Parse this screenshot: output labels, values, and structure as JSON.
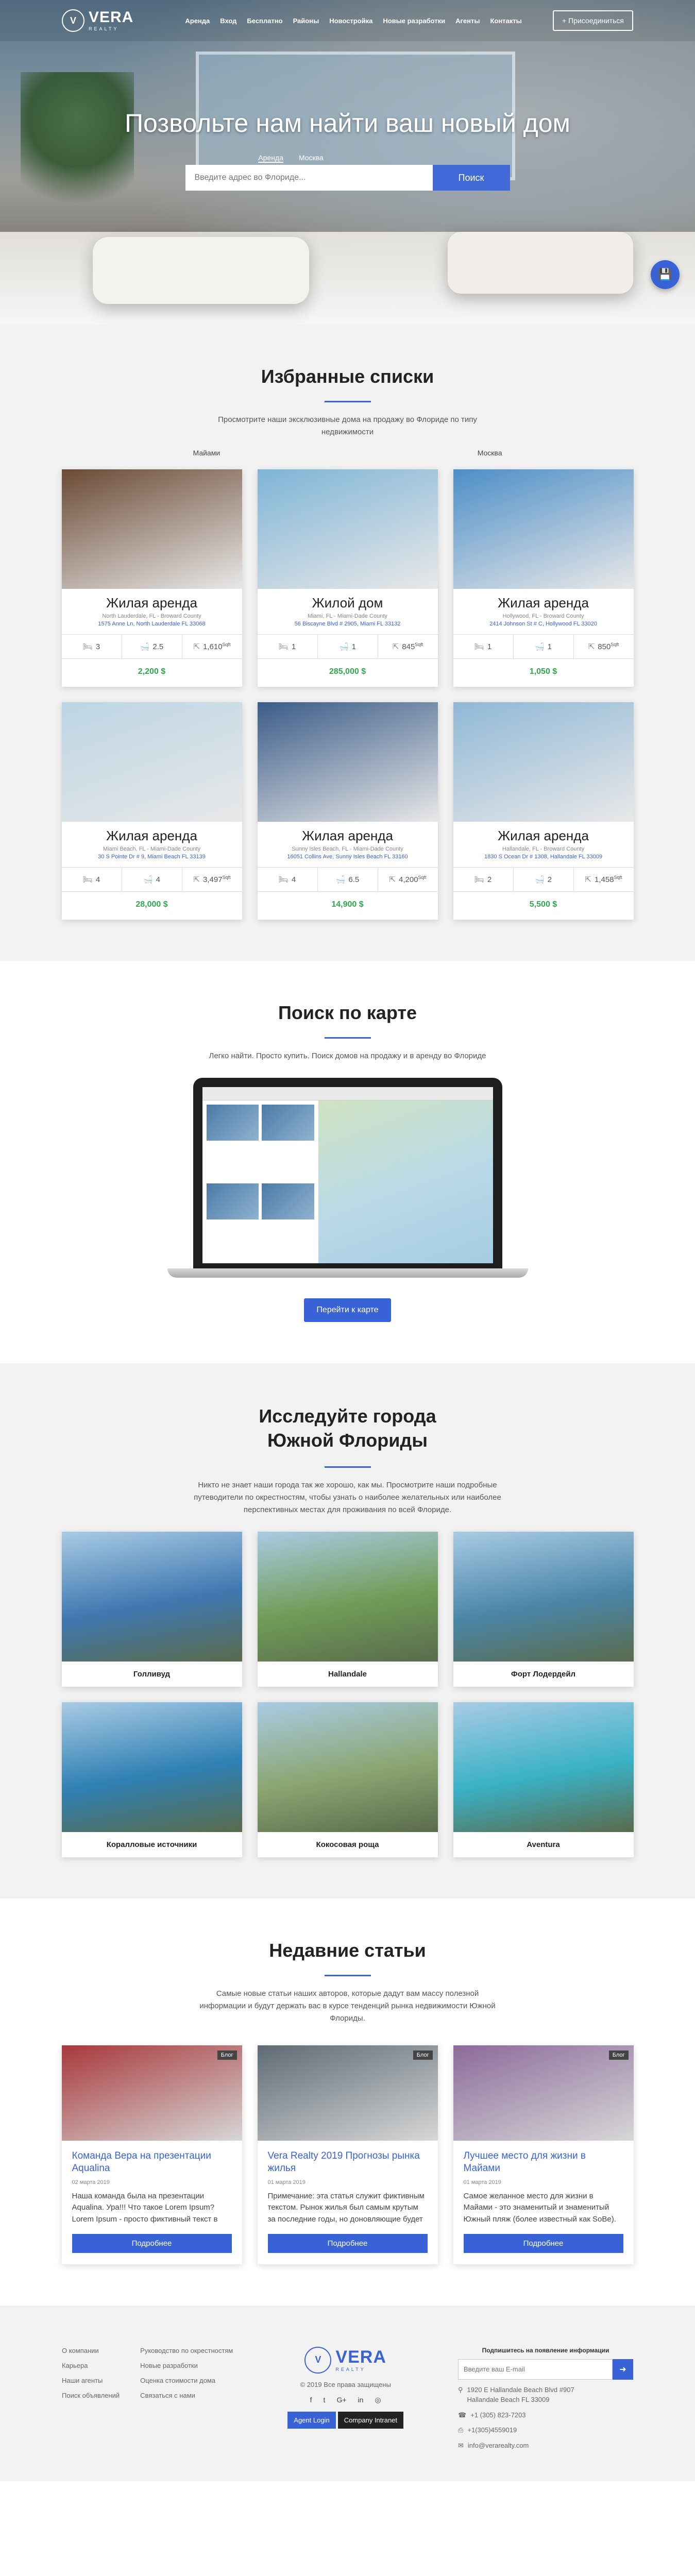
{
  "nav": {
    "logo_big": "VERA",
    "logo_small": "REALTY",
    "links": [
      "Аренда",
      "Вход",
      "Бесплатно",
      "Районы",
      "Новостройка",
      "Новые разработки",
      "Агенты",
      "Контакты"
    ],
    "join": "+ Присоединиться"
  },
  "hero": {
    "title": "Позвольте нам найти ваш новый дом",
    "tabs": [
      "Аренда",
      "Москва"
    ],
    "placeholder": "Введите адрес во Флориде...",
    "search_btn": "Поиск",
    "fab_icon": "save-icon"
  },
  "featured": {
    "title": "Избранные списки",
    "subtitle": "Просмотрите наши эксклюзивные дома на продажу во Флориде по типу недвижимости",
    "tabs": [
      "Майами",
      "Москва"
    ],
    "cards": [
      {
        "title": "Жилая аренда",
        "sub": "North Lauderdale, FL - Broward County",
        "addr": "1575 Anne Ln, North Lauderdale FL 33068",
        "beds": "3",
        "baths": "2.5",
        "area": "1,610",
        "price": "2,200 $"
      },
      {
        "title": "Жилой дом",
        "sub": "Miami, FL - Miami-Dade County",
        "addr": "56 Biscayne Blvd # 2905, Miami FL 33132",
        "beds": "1",
        "baths": "1",
        "area": "845",
        "price": "285,000 $"
      },
      {
        "title": "Жилая аренда",
        "sub": "Hollywood, FL - Broward County",
        "addr": "2414 Johnson St # C, Hollywood FL 33020",
        "beds": "1",
        "baths": "1",
        "area": "850",
        "price": "1,050 $"
      },
      {
        "title": "Жилая аренда",
        "sub": "Miami Beach, FL - Miami-Dade County",
        "addr": "30 S Pointe Dr # 9, Miami Beach FL 33139",
        "beds": "4",
        "baths": "4",
        "area": "3,497",
        "price": "28,000 $"
      },
      {
        "title": "Жилая аренда",
        "sub": "Sunny Isles Beach, FL - Miami-Dade County",
        "addr": "16051 Collins Ave, Sunny Isles Beach FL 33160",
        "beds": "4",
        "baths": "6.5",
        "area": "4,200",
        "price": "14,900 $"
      },
      {
        "title": "Жилая аренда",
        "sub": "Hallandale, FL - Broward County",
        "addr": "1830 S Ocean Dr # 1308, Hallandale FL 33009",
        "beds": "2",
        "baths": "2",
        "area": "1,458",
        "price": "5,500 $"
      }
    ],
    "area_unit": "Sqft",
    "colors": [
      "#6b4a34",
      "#7eb4d6",
      "#4c8ec7",
      "#bcd5e4",
      "#3b5c88",
      "#8fb8d6"
    ]
  },
  "map_search": {
    "title": "Поиск по карте",
    "subtitle": "Легко найти. Просто купить. Поиск домов на продажу и в аренду во Флориде",
    "button": "Перейти к карте"
  },
  "cities": {
    "title": "Исследуйте города Южной Флориды",
    "subtitle": "Никто не знает наши города так же хорошо, как мы. Просмотрите наши подробные путеводители по окрестностям, чтобы узнать о наиболее желательных или наиболее перспективных местах для проживания по всей Флориде.",
    "items": [
      "Голливуд",
      "Hallandale",
      "Форт Лодердейл",
      "Коралловые источники",
      "Кокосовая роща",
      "Aventura"
    ],
    "colors": [
      "#3f78b0",
      "#6f9c57",
      "#4a86a8",
      "#2f80b3",
      "#8aa570",
      "#39b1c6"
    ]
  },
  "articles": {
    "title": "Недавние статьи",
    "subtitle": "Самые новые статьи наших авторов, которые дадут вам массу полезной информации и будут держать вас в курсе тенденций рынка недвижимости Южной Флориды.",
    "badge": "Блог",
    "button": "Подробнее",
    "items": [
      {
        "title": "Команда Вера на презентации Aqualina",
        "date": "02 марта 2019",
        "text": "Наша команда была на презентации Aqualina. Ура!!! Что такое Lorem Ipsum? Lorem Ipsum - просто фиктивный текст в полиграфии и верстке. Лорем Ипсум"
      },
      {
        "title": "Vera Realty 2019 Прогнозы рынка жилья",
        "date": "01 марта 2019",
        "text": "Примечание: эта статья служит фиктивным текстом. Рынок жилья был самым крутым за последние годы, но доновляющие будет расти..."
      },
      {
        "title": "Лучшее место для жизни в Майами",
        "date": "01 марта 2019",
        "text": "Самое желанное место для жизни в Майами - это знаменитый и знаменитый Южный пляж (более известный как SoBe). Это..."
      }
    ],
    "colors": [
      "#a8383b",
      "#5e6b74",
      "#8c6a9b"
    ]
  },
  "footer": {
    "col1": [
      "О компании",
      "Карьера",
      "Наши агенты",
      "Поиск объявлений"
    ],
    "col2": [
      "Руководство по окрестностям",
      "Новые разработки",
      "Оценка стоимости дома",
      "Связаться с нами"
    ],
    "copyright": "© 2019 Все права защищены",
    "socials": [
      "f",
      "t",
      "G+",
      "in",
      "◎"
    ],
    "agent_login": "Agent Login",
    "company_intranet": "Company Intranet",
    "subscribe_label": "Подпишитесь на появление информации",
    "email_placeholder": "Введите ваш E-mail",
    "address_line1": "1920 E Hallandale Beach Blvd #907",
    "address_line2": "Hallandale Beach FL 33009",
    "phone": "+1 (305) 823-7203",
    "fax": "+1(305)4559019",
    "email": "info@verarealty.com"
  }
}
